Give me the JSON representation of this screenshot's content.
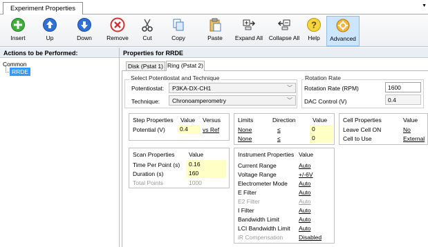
{
  "window": {
    "tab_title": "Experiment Properties"
  },
  "toolbar": {
    "items": [
      {
        "label": "Insert",
        "icon": "insert-icon"
      },
      {
        "label": "Up",
        "icon": "up-icon"
      },
      {
        "label": "Down",
        "icon": "down-icon"
      },
      {
        "label": "Remove",
        "icon": "remove-icon"
      },
      {
        "label": "Cut",
        "icon": "cut-icon"
      },
      {
        "label": "Copy",
        "icon": "copy-icon"
      },
      {
        "label": "Paste",
        "icon": "paste-icon"
      },
      {
        "label": "Expand All",
        "icon": "expand-all-icon"
      },
      {
        "label": "Collapse All",
        "icon": "collapse-all-icon"
      },
      {
        "label": "Help",
        "icon": "help-icon"
      },
      {
        "label": "Advanced",
        "icon": "advanced-icon"
      }
    ]
  },
  "left_panel": {
    "title": "Actions to be Performed:",
    "tree_root": "Common",
    "tree_item": "RRDE"
  },
  "right_panel": {
    "title": "Properties for RRDE",
    "tabs": [
      "Disk (Pstat 1)",
      "Ring (Pstat 2)"
    ]
  },
  "potentiostat_group": {
    "title": "Select Potentiostat and Technique",
    "potentiostat_label": "Potentiostat:",
    "potentiostat_value": "P3KA-DX-CH1",
    "technique_label": "Technique:",
    "technique_value": "Chronoamperometry"
  },
  "rotation_group": {
    "title": "Rotation Rate",
    "rpm_label": "Rotation Rate (RPM)",
    "rpm_value": "1600",
    "dac_label": "DAC Control (V)",
    "dac_value": "0.4"
  },
  "step_table": {
    "headers": [
      "Step Properties",
      "Value",
      "Versus"
    ],
    "rows": [
      [
        "Potential (V)",
        "0.4",
        "vs Ref"
      ]
    ]
  },
  "limits_table": {
    "headers": [
      "Limits",
      "Direction",
      "Value"
    ],
    "rows": [
      [
        "None",
        "≤",
        "0"
      ],
      [
        "None",
        "≤",
        "0"
      ]
    ]
  },
  "cell_table": {
    "headers": [
      "Cell Properties",
      "Value"
    ],
    "rows": [
      [
        "Leave Cell ON",
        "No"
      ],
      [
        "Cell to Use",
        "External"
      ]
    ]
  },
  "scan_table": {
    "headers": [
      "Scan Properties",
      "Value"
    ],
    "rows": [
      [
        "Time Per Point (s)",
        "0.16"
      ],
      [
        "Duration (s)",
        "160"
      ],
      [
        "Total Points",
        "1000"
      ]
    ]
  },
  "instrument_table": {
    "headers": [
      "Instrument Properties",
      "Value"
    ],
    "rows": [
      [
        "Current Range",
        "Auto"
      ],
      [
        "Voltage Range",
        "+/-6V"
      ],
      [
        "Electrometer Mode",
        "Auto"
      ],
      [
        "E Filter",
        "Auto"
      ],
      [
        "E2 Filter",
        "Auto"
      ],
      [
        "I Filter",
        "Auto"
      ],
      [
        "Bandwidth Limit",
        "Auto"
      ],
      [
        "LCI Bandwidth Limit",
        "Auto"
      ],
      [
        "iR Compensation",
        "Disabled"
      ]
    ]
  }
}
